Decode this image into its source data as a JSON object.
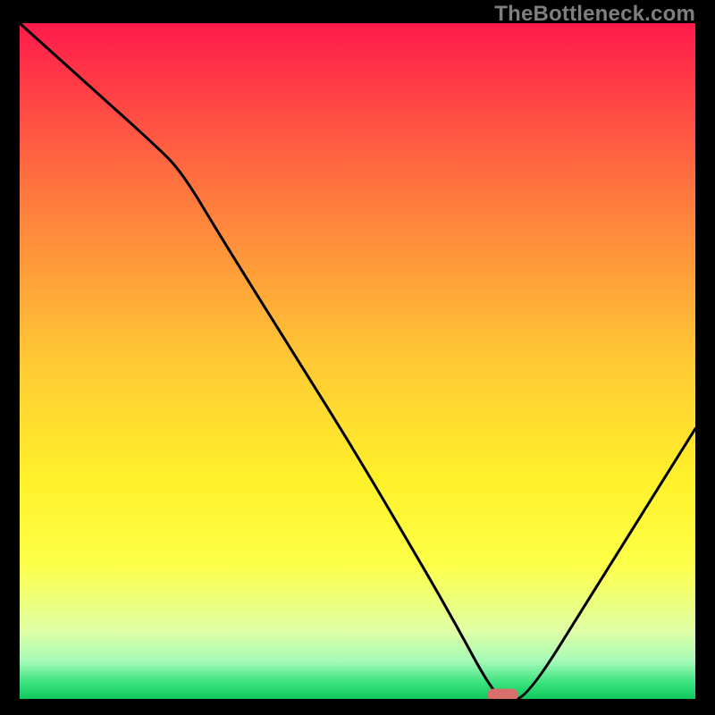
{
  "watermark": "TheBottleneck.com",
  "chart_data": {
    "type": "line",
    "title": "",
    "xlabel": "",
    "ylabel": "",
    "xlim": [
      0,
      100
    ],
    "ylim": [
      0,
      100
    ],
    "grid": false,
    "series": [
      {
        "name": "curve",
        "x": [
          0,
          10,
          20,
          24,
          30,
          40,
          50,
          60,
          64,
          70,
          72,
          75,
          85,
          95,
          100
        ],
        "y": [
          100,
          91,
          82,
          78,
          68,
          52,
          36,
          19,
          12,
          1,
          0,
          0,
          16,
          32,
          40
        ]
      }
    ],
    "marker": {
      "x": 71.5,
      "y": 0.6,
      "color": "#d86f6d"
    },
    "gradient_stops": [
      {
        "offset": 0.0,
        "color": "#ff1a4b"
      },
      {
        "offset": 0.25,
        "color": "#ff773e"
      },
      {
        "offset": 0.5,
        "color": "#ffc934"
      },
      {
        "offset": 0.68,
        "color": "#fff22a"
      },
      {
        "offset": 0.8,
        "color": "#fdff48"
      },
      {
        "offset": 0.9,
        "color": "#dfffa6"
      },
      {
        "offset": 0.945,
        "color": "#a3f9b7"
      },
      {
        "offset": 0.975,
        "color": "#3de37e"
      },
      {
        "offset": 1.0,
        "color": "#10c95e"
      }
    ]
  }
}
